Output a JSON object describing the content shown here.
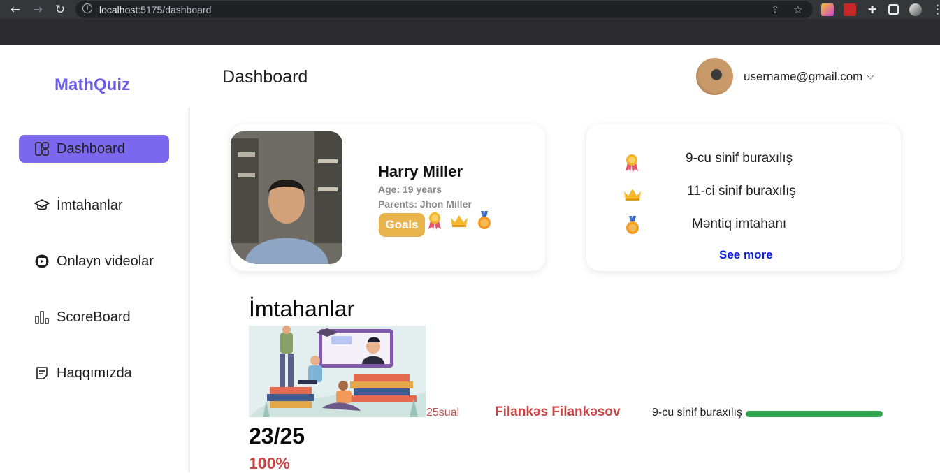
{
  "browser": {
    "url_host": "localhost",
    "url_path": ":5175/dashboard"
  },
  "sidebar": {
    "logo": "MathQuiz",
    "items": [
      {
        "label": "Dashboard",
        "icon": "layout-icon",
        "active": true
      },
      {
        "label": "İmtahanlar",
        "icon": "graduation-cap-icon",
        "active": false
      },
      {
        "label": "Onlayn videolar",
        "icon": "video-play-icon",
        "active": false
      },
      {
        "label": "ScoreBoard",
        "icon": "bar-chart-icon",
        "active": false
      },
      {
        "label": "Haqqımızda",
        "icon": "note-icon",
        "active": false
      }
    ]
  },
  "header": {
    "title": "Dashboard",
    "user_email": "username@gmail.com"
  },
  "profile": {
    "name": "Harry Miller",
    "age": "Age: 19 years",
    "parents": "Parents: Jhon Miller",
    "goals_label": "Goals"
  },
  "achievements": {
    "items": [
      {
        "label": "9-cu sinif buraxılış",
        "icon": "award-ribbon-icon"
      },
      {
        "label": "11-ci sinif buraxılış",
        "icon": "crown-icon"
      },
      {
        "label": "Məntiq imtahanı",
        "icon": "medal-icon"
      }
    ],
    "see_more": "See more"
  },
  "exams": {
    "title": "İmtahanlar",
    "item": {
      "questions": "25sual",
      "author": "Filankəs Filankəsov",
      "name": "9-cu sinif buraxılış",
      "progress": 1.0,
      "score": "23/25",
      "percent": "100%"
    }
  },
  "colors": {
    "accent": "#7b68ee",
    "logo": "#6c5ce7",
    "goals": "#e9b44c",
    "danger": "#c94545",
    "progress": "#2ea44f",
    "link": "#0a1fd8"
  }
}
